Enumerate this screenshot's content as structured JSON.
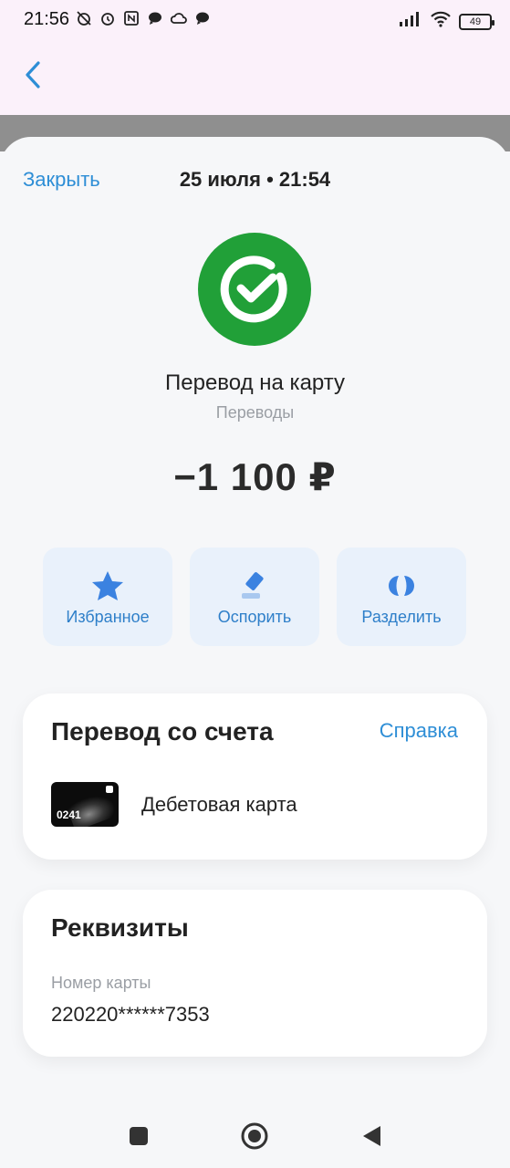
{
  "status_bar": {
    "time": "21:56",
    "battery": "49",
    "left_icons": [
      "alarm-off-icon",
      "alarm-icon",
      "nfc-icon",
      "chat-icon",
      "cloud-icon",
      "message-icon"
    ],
    "right_icons": [
      "signal-icon",
      "wifi-icon",
      "battery-icon"
    ]
  },
  "app_bar": {
    "back_icon": "chevron-left-icon"
  },
  "sheet": {
    "close_label": "Закрыть",
    "datetime": "25 июля • 21:54",
    "logo_icon": "sber-logo-icon",
    "title": "Перевод на карту",
    "subtitle": "Переводы",
    "amount": "−1 100 ₽"
  },
  "actions": [
    {
      "label": "Избранное",
      "icon": "star-icon"
    },
    {
      "label": "Оспорить",
      "icon": "gavel-icon"
    },
    {
      "label": "Разделить",
      "icon": "split-icon"
    }
  ],
  "source_card": {
    "title": "Перевод со счета",
    "help_label": "Справка",
    "card_last_digits": "0241",
    "account_name": "Дебетовая карта"
  },
  "requisites_card": {
    "title": "Реквизиты",
    "field_label": "Номер карты",
    "field_value": "220220******7353"
  },
  "colors": {
    "accent": "#2e8ed6",
    "sber_green": "#21a038",
    "action_bg": "#e9f1fb"
  },
  "nav_bar": [
    "square-icon",
    "circle-icon",
    "triangle-back-icon"
  ]
}
